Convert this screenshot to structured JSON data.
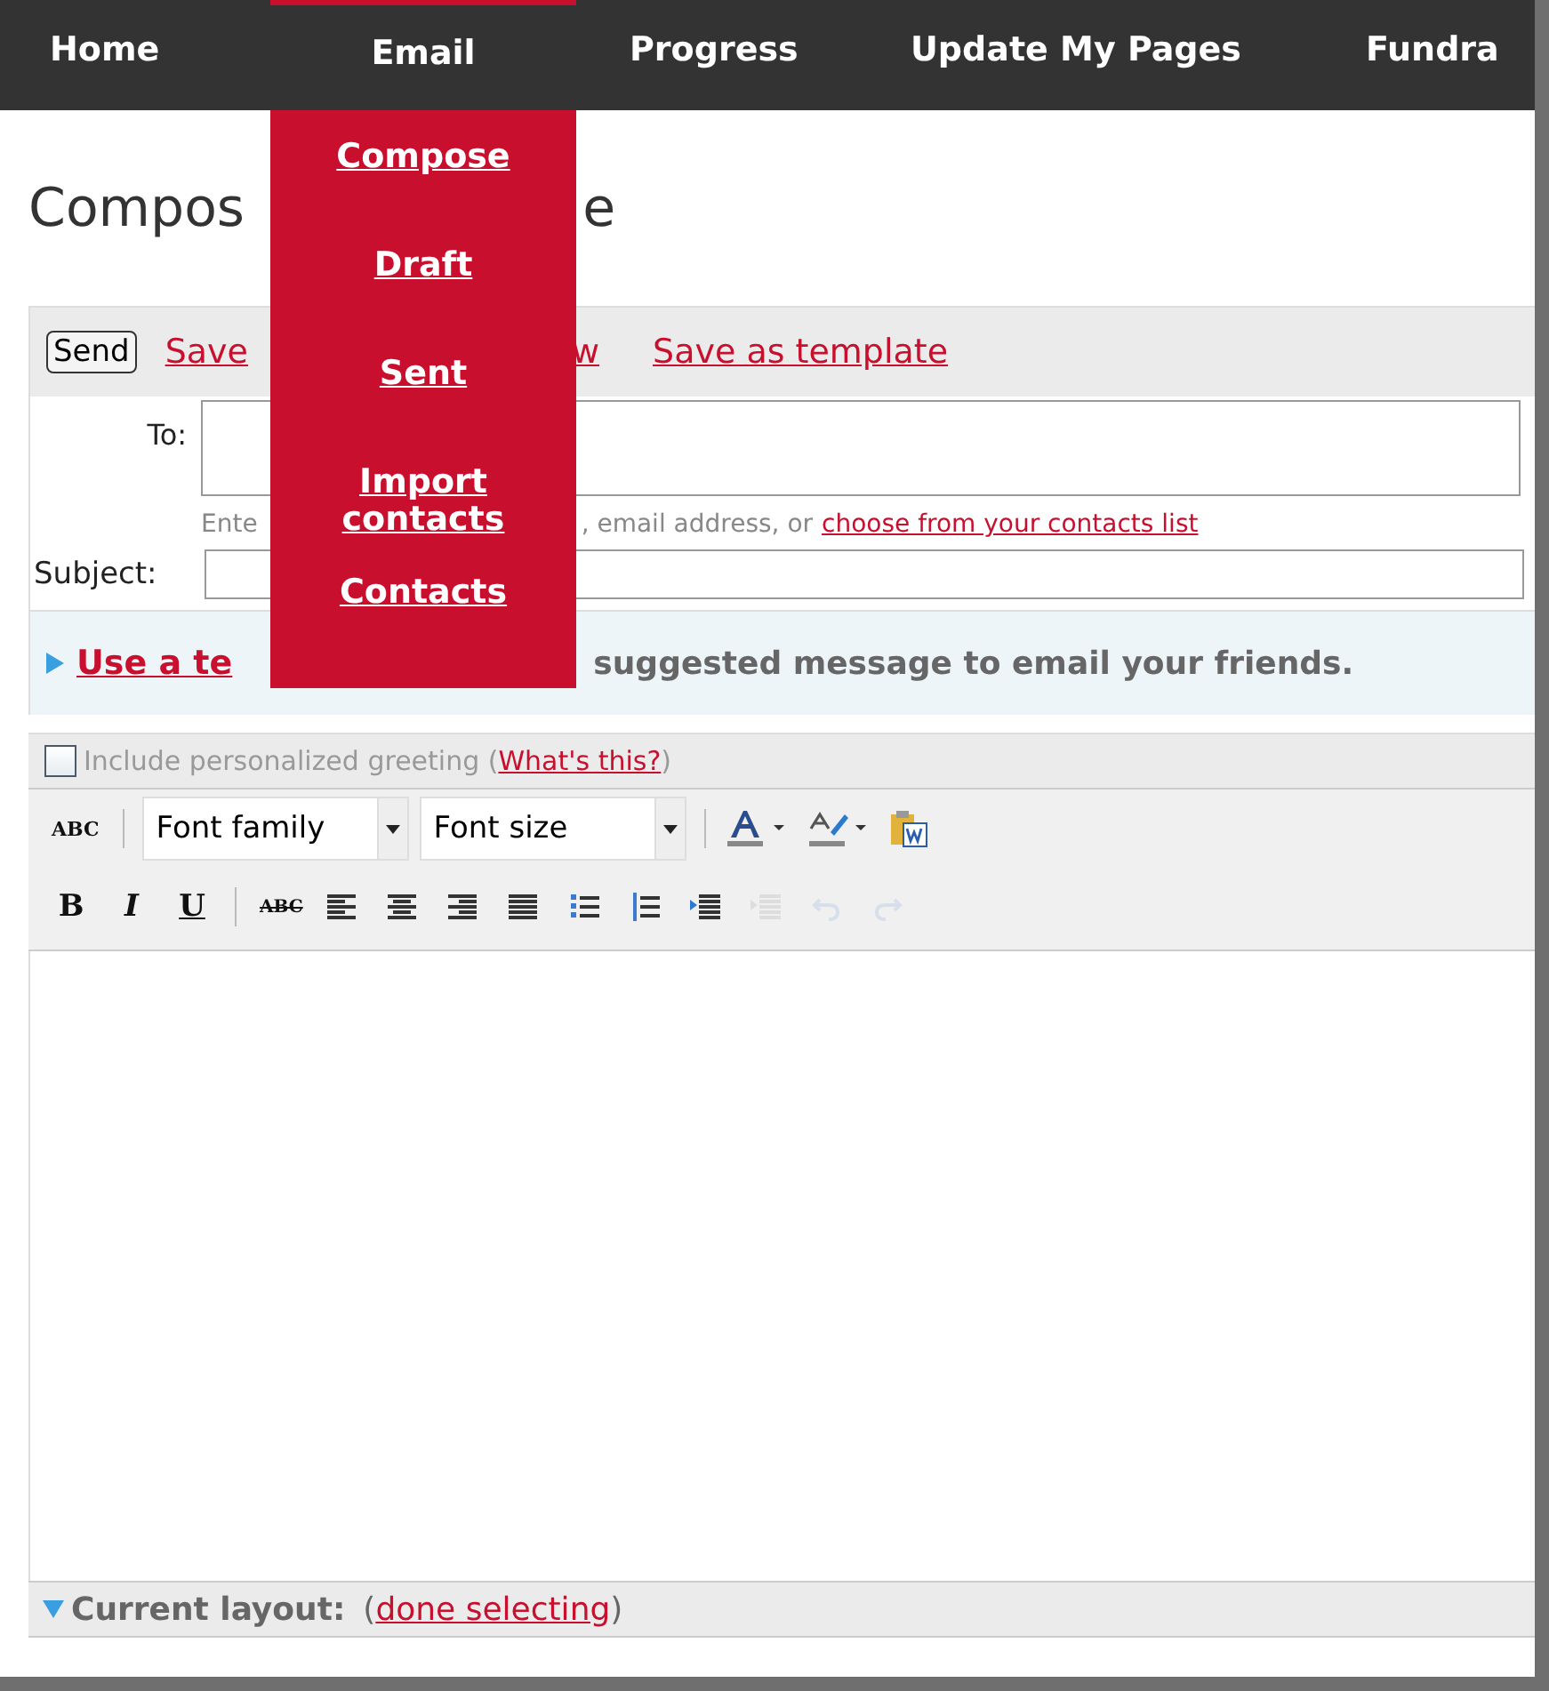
{
  "nav": {
    "items": [
      {
        "label": "Home",
        "selected": false
      },
      {
        "label": "Email",
        "selected": true
      },
      {
        "label": "Progress",
        "selected": false
      },
      {
        "label": "Update My Pages",
        "selected": false
      },
      {
        "label": "Fundra",
        "selected": false
      }
    ]
  },
  "nav_menu": {
    "items": [
      "Compose",
      "Draft",
      "Sent",
      "Import contacts",
      "Contacts"
    ]
  },
  "page_title": {
    "left": "Compos",
    "right": "e"
  },
  "compose_toolbar": {
    "send": "Send",
    "links": [
      "Save",
      "w",
      "Save as template"
    ]
  },
  "to": {
    "label": "To:",
    "hint": [
      "Ente",
      ", email address, or "
    ],
    "hint_link": "choose from your contacts list"
  },
  "subject": {
    "label": "Subject:"
  },
  "template_tip": {
    "link": "Use a te",
    "text": "suggested message to email your friends."
  },
  "greeting": {
    "checked": false,
    "text": "Include personalized greeting (",
    "link": "What's this?",
    "close": ")"
  },
  "editor_toolbar": {
    "spellcheck": "ABC",
    "font_family": "Font family",
    "font_size": "Font size",
    "format": [
      "B",
      "I",
      "U"
    ],
    "strike": "ABC",
    "tools": [
      {
        "kind": "align-left",
        "disabled": false
      },
      {
        "kind": "align-center",
        "disabled": false
      },
      {
        "kind": "align-right",
        "disabled": false
      },
      {
        "kind": "justify",
        "disabled": false
      },
      {
        "kind": "bullets",
        "disabled": false
      },
      {
        "kind": "numbers",
        "disabled": false
      },
      {
        "kind": "indent",
        "disabled": false
      },
      {
        "kind": "outdent",
        "disabled": true
      },
      {
        "kind": "undo",
        "disabled": true
      },
      {
        "kind": "redo",
        "disabled": true
      }
    ]
  },
  "footer": {
    "label": "Current layout:",
    "open": "(",
    "link": "done selecting",
    "close": ")"
  }
}
